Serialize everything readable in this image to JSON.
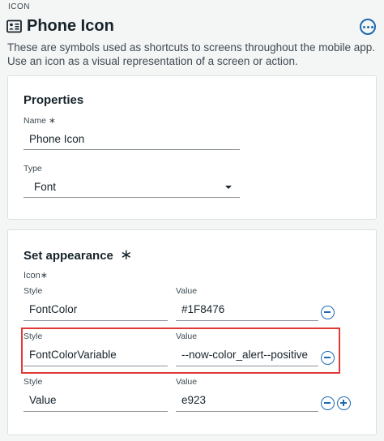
{
  "header": {
    "eyebrow": "ICON",
    "title": "Phone Icon",
    "description": "These are symbols used as shortcuts to screens throughout the mobile app. Use an icon as a visual representation of a screen or action."
  },
  "properties": {
    "heading": "Properties",
    "name_label": "Name",
    "required_mark": "∗",
    "name_value": "Phone Icon",
    "type_label": "Type",
    "type_value": "Font"
  },
  "appearance": {
    "heading": "Set appearance",
    "required_mark": "∗",
    "icon_label": "Icon",
    "icon_required_mark": "∗",
    "rows": [
      {
        "style_label": "Style",
        "style_value": "FontColor",
        "value_label": "Value",
        "value": "#1F8476"
      },
      {
        "style_label": "Style",
        "style_value": "FontColorVariable",
        "value_label": "Value",
        "value": "--now-color_alert--positive"
      },
      {
        "style_label": "Style",
        "style_value": "Value",
        "value_label": "Value",
        "value": "e923"
      }
    ]
  },
  "icons": {
    "title_icon": "contact-card-icon",
    "more": "more-options-icon",
    "remove": "minus-circle-icon",
    "add": "plus-circle-icon",
    "dropdown": "caret-down-icon"
  },
  "colors": {
    "accent": "#1e6ab0",
    "highlight": "#e03a37",
    "text": "#17232b",
    "background": "#f4f5f5"
  }
}
